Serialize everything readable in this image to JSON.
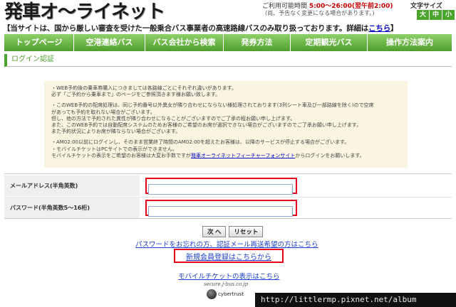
{
  "header": {
    "logo": "発車オ〜ライネット",
    "hours_label": "ご利用可能時間",
    "hours_value": "5:00〜26:00(翌午前2:00)",
    "hours_note": "(尚、予告なく変更になる場合があります。)",
    "font_size_label": "文字サイズ",
    "font_sizes": [
      "大",
      "中",
      "小"
    ]
  },
  "notice": {
    "text": "【当サイトは、国から厳しい審査を受けた一般乗合バス事業者の高速路線バスのみ取り扱っております。詳細は",
    "link": "こちら",
    "close": "】"
  },
  "nav": {
    "items": [
      "トップページ",
      "空港連絡バス",
      "バス会社から検索",
      "発券方法",
      "定期観光バス",
      "操作方法案内"
    ]
  },
  "page_title": "ログイン認証",
  "info": {
    "lines_a": [
      "・WEB予約後の乗車券購入につきましては各路線ごとにそれぞれ違いがあります。",
      "必ず「ご予約から乗車まで」のページをご参照頂きます様お願い致します。"
    ],
    "lines_b": [
      "・このWEB予約の配席処理は、同じ予約番号以外異女が隣り合わせにならない様処理されております(3列シート車及び一部路線を除く)ので空席",
      "があっても予約を取れない場合がございます。",
      "但し、他の方法で予約された異性が隣り合わせになることがございますのでご了承の程お願い申し上げます。",
      "また、このWEB予約では自動配席システムのためお客様のご希望のお席が選択できない場合がございますのでご了承お願い申し上げます。",
      "また予約状況によりお席が隣ならない場合がございます。"
    ],
    "lines_c": [
      "・AM02:00以前にログインし、そのまま営業終了時間のAM02:00を超えたお客様は、以降のサービスが停止する場合がございます。",
      "・モバイルチケットはPCサイトでの表示ができません。"
    ],
    "last_prefix": "モバイルチケットの表示をご希望のお客様は大変お手数ですが",
    "last_link": "発車オーライネットフィーチャーフォンサイト",
    "last_suffix": "からログインをお願いします。"
  },
  "form": {
    "email_label": "メールアドレス(半角英数)",
    "email_value": "",
    "password_label": "パスワード(半角英数5〜16桁)",
    "password_value": ""
  },
  "buttons": {
    "next": "次 へ",
    "reset": "リセット"
  },
  "links": {
    "forgot": "パスワードをお忘れの方、認証メール再送希望の方はこちら",
    "new_member": "新規会員登録はこちらから",
    "mobile_ticket": "モバイルチケットの表示はこちら"
  },
  "footer": {
    "domain": "secure.j-bus.co.jp",
    "badge": "cybertrust"
  },
  "watermark": "http://littlermp.pixnet.net/album"
}
